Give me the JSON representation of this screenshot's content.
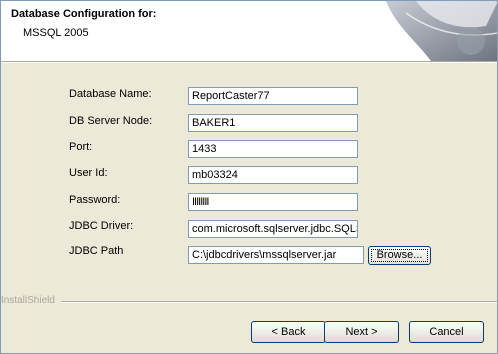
{
  "header": {
    "title": "Database Configuration for:",
    "subtitle": "MSSQL 2005"
  },
  "form": {
    "database_name": {
      "label": "Database Name:",
      "value": "ReportCaster77"
    },
    "db_server_node": {
      "label": "DB Server Node:",
      "value": "BAKER1"
    },
    "port": {
      "label": "Port:",
      "value": "1433"
    },
    "user_id": {
      "label": "User Id:",
      "value": "mb03324"
    },
    "password": {
      "label": "Password:",
      "value": "IIIIIIII"
    },
    "jdbc_driver": {
      "label": "JDBC Driver:",
      "value": "com.microsoft.sqlserver.jdbc.SQLS"
    },
    "jdbc_path": {
      "label": "JDBC Path",
      "value": "C:\\jdbcdrivers\\mssqlserver.jar"
    }
  },
  "buttons": {
    "browse": "Browse...",
    "back": "< Back",
    "next": "Next >",
    "cancel": "Cancel"
  },
  "footer": {
    "brand": "InstallShield"
  }
}
